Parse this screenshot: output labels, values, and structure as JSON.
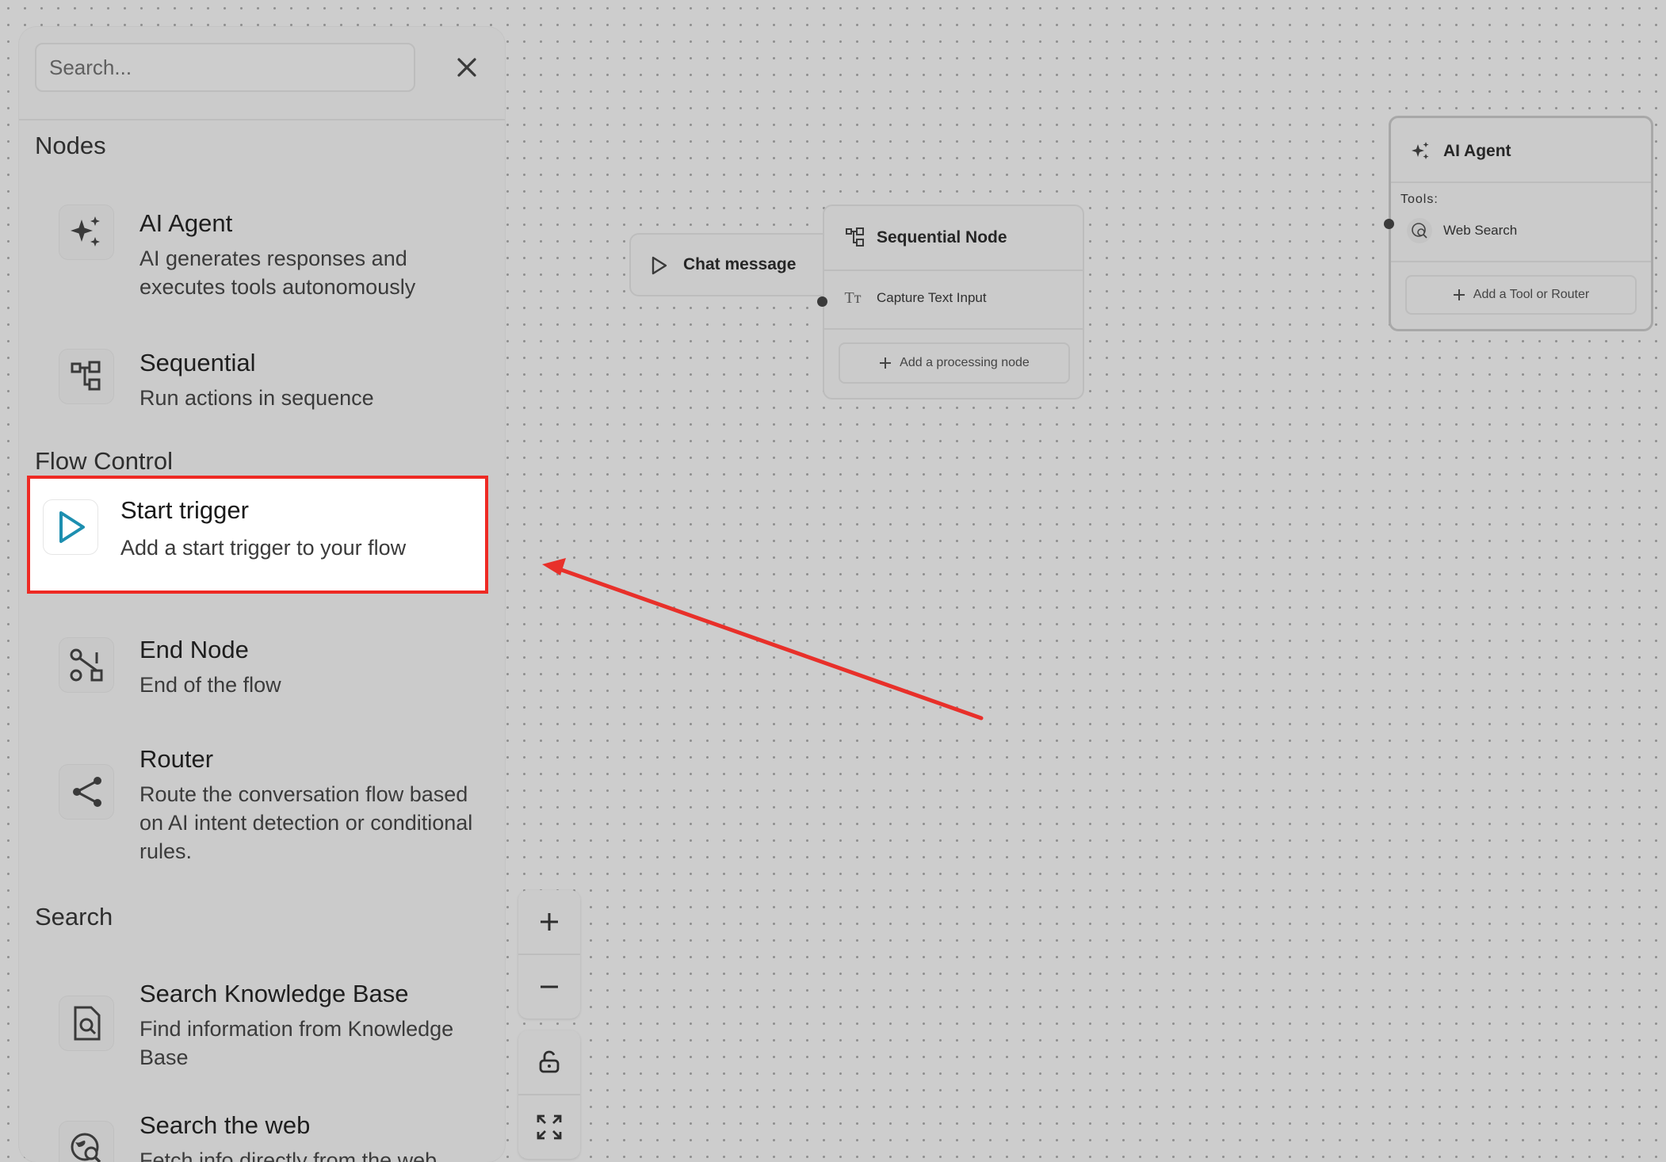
{
  "search": {
    "placeholder": "Search..."
  },
  "sections": {
    "nodes": "Nodes",
    "flow_control": "Flow Control",
    "search": "Search"
  },
  "items": {
    "ai_agent": {
      "title": "AI Agent",
      "desc": "AI generates responses and executes tools autonomously",
      "icon": "sparkles-icon"
    },
    "sequential": {
      "title": "Sequential",
      "desc": "Run actions in sequence",
      "icon": "sequence-icon"
    },
    "start_trigger": {
      "title": "Start trigger",
      "desc": "Add a start trigger to your flow",
      "icon": "play-icon"
    },
    "end_node": {
      "title": "End Node",
      "desc": "End of the flow",
      "icon": "end-node-icon"
    },
    "router": {
      "title": "Router",
      "desc": "Route the conversation flow based on AI intent detection or conditional rules.",
      "icon": "router-icon"
    },
    "search_kb": {
      "title": "Search Knowledge Base",
      "desc": "Find information from Knowledge Base",
      "icon": "document-search-icon"
    },
    "search_web": {
      "title": "Search the web",
      "desc": "Fetch info directly from the web",
      "icon": "web-search-icon"
    }
  },
  "canvas": {
    "chat_node": {
      "label": "Chat message"
    },
    "sequential_node": {
      "title": "Sequential Node",
      "step": "Capture Text Input",
      "add": "Add a processing node"
    },
    "agent_node": {
      "title": "AI Agent",
      "tools_label": "Tools:",
      "tool": "Web Search",
      "add": "Add a Tool or Router"
    }
  },
  "colors": {
    "highlight_border": "#ee2a24",
    "arrow": "#e8302a",
    "play_icon": "#1d8fb0"
  }
}
